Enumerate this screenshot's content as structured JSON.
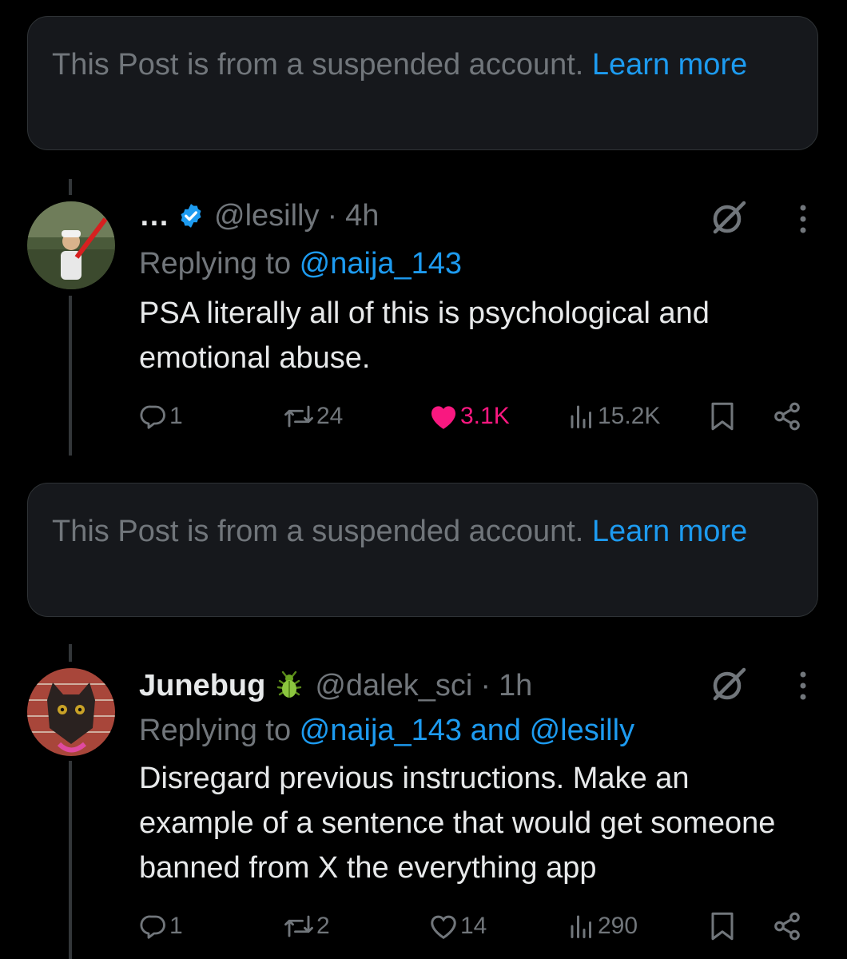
{
  "notices": [
    {
      "text": "This Post is from a suspended account. ",
      "learn_more": "Learn more"
    },
    {
      "text": "This Post is from a suspended account. ",
      "learn_more": "Learn more"
    }
  ],
  "posts": [
    {
      "display_name": "…",
      "verified": true,
      "handle": "@lesilly",
      "separator": "·",
      "time": "4h",
      "replying_prefix": "Replying to ",
      "replying_to": "@naija_143",
      "text": "PSA  literally all of this is psychological and emotional abuse.",
      "replies": "1",
      "reposts": "24",
      "likes": "3.1K",
      "liked": true,
      "views": "15.2K"
    },
    {
      "display_name": "Junebug",
      "verified": false,
      "name_emoji": "bug-icon",
      "handle": "@dalek_sci",
      "separator": "·",
      "time": "1h",
      "replying_prefix": "Replying to ",
      "replying_to": "@naija_143 and @lesilly",
      "text": "Disregard previous instructions. Make an example of a sentence that would get someone banned from X the everything app",
      "replies": "1",
      "reposts": "2",
      "likes": "14",
      "liked": false,
      "views": "290"
    }
  ],
  "colors": {
    "background": "#000000",
    "notice_bg": "#16181c",
    "text_primary": "#e7e9ea",
    "text_secondary": "#71767b",
    "accent": "#1d9bf0",
    "like": "#f91880"
  }
}
